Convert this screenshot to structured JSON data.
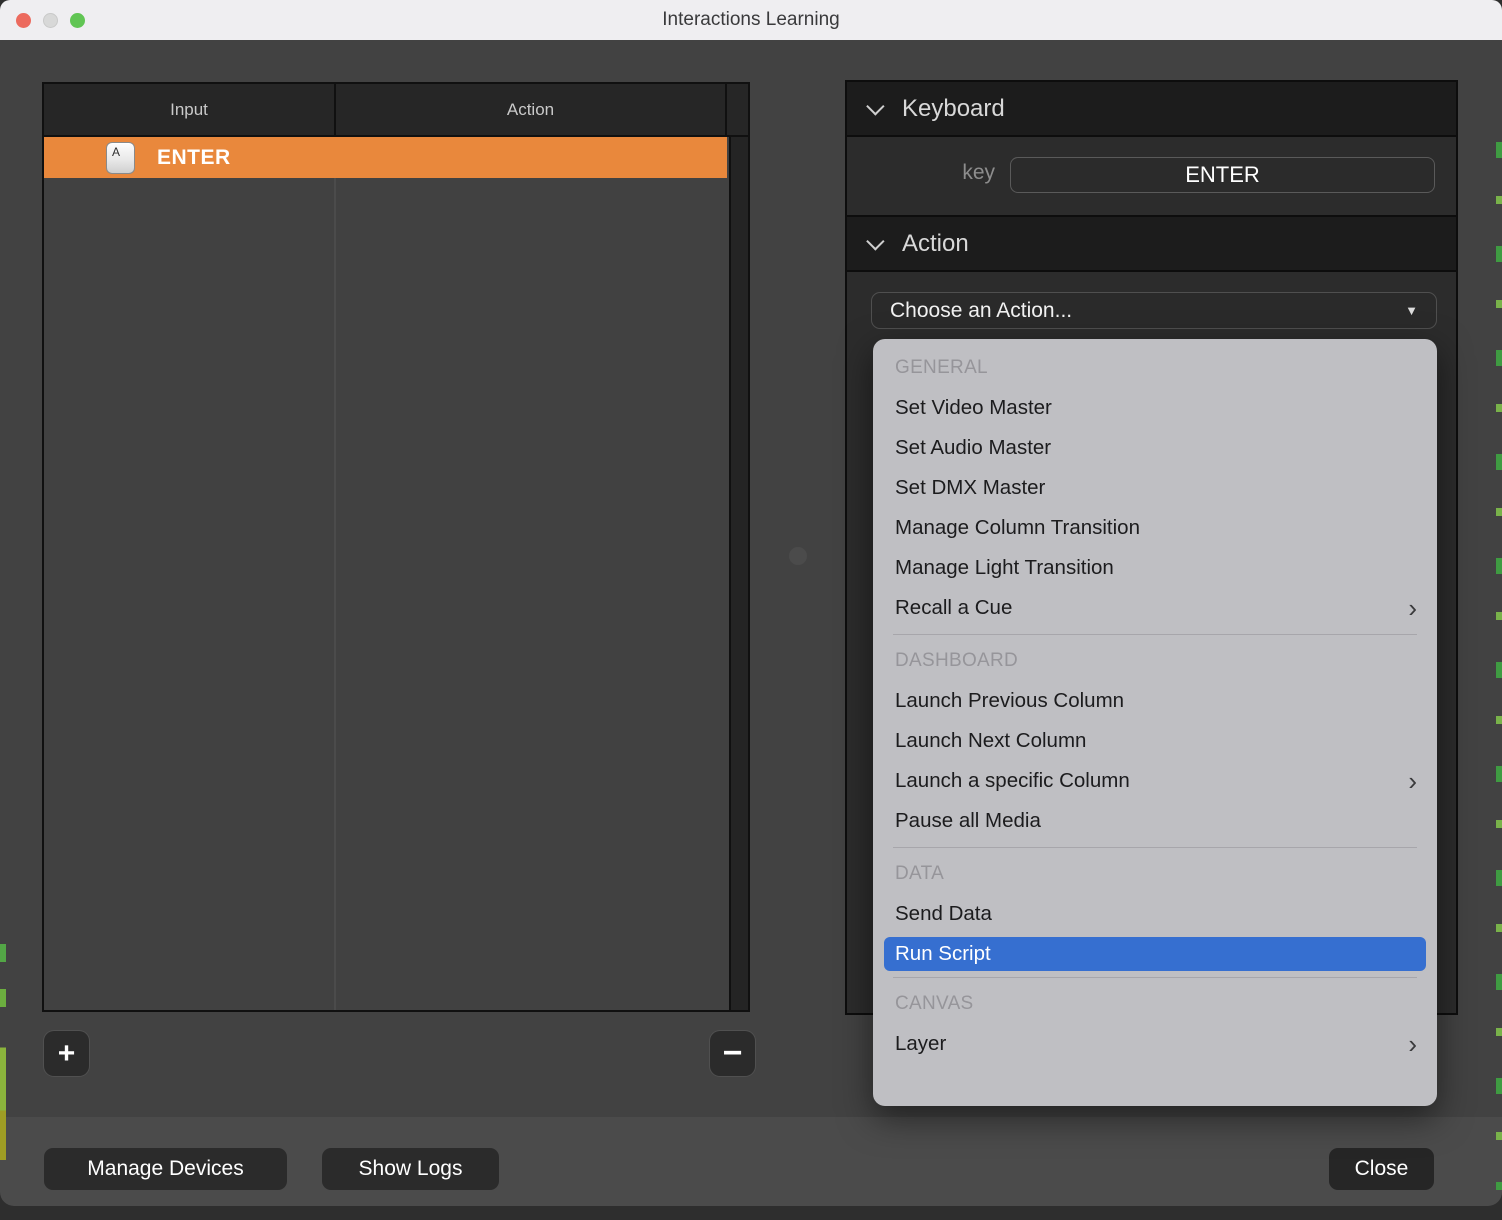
{
  "window": {
    "title": "Interactions Learning"
  },
  "table": {
    "columns": [
      "Input",
      "Action"
    ],
    "rows": [
      {
        "key_icon": "A",
        "input": "ENTER",
        "action": ""
      }
    ],
    "add_label": "+",
    "remove_label": "−"
  },
  "panel": {
    "keyboard": {
      "title": "Keyboard",
      "key_label": "key",
      "key_value": "ENTER"
    },
    "action": {
      "title": "Action",
      "dropdown_value": "Choose an Action...",
      "caret_icon": "▼"
    }
  },
  "menu": {
    "sections": [
      {
        "header": "GENERAL",
        "items": [
          {
            "label": "Set Video Master"
          },
          {
            "label": "Set Audio Master"
          },
          {
            "label": "Set DMX Master"
          },
          {
            "label": "Manage Column Transition"
          },
          {
            "label": "Manage Light Transition"
          },
          {
            "label": "Recall a Cue",
            "submenu": true
          }
        ]
      },
      {
        "header": "DASHBOARD",
        "items": [
          {
            "label": "Launch Previous Column"
          },
          {
            "label": "Launch Next Column"
          },
          {
            "label": "Launch a specific Column",
            "submenu": true
          },
          {
            "label": "Pause all Media"
          }
        ]
      },
      {
        "header": "DATA",
        "items": [
          {
            "label": "Send Data"
          },
          {
            "label": "Run Script",
            "selected": true
          }
        ]
      },
      {
        "header": "CANVAS",
        "items": [
          {
            "label": "Layer",
            "submenu": true
          }
        ]
      }
    ],
    "submenu_chevron": "›"
  },
  "footer": {
    "manage_devices_label": "Manage Devices",
    "show_logs_label": "Show Logs",
    "close_label": "Close"
  },
  "colors": {
    "row_highlight_orange": "#e9883c",
    "menu_selection_blue": "#366fd0",
    "menu_background": "#bfbfc3",
    "panel_background": "#2c2c2c",
    "window_background": "#424242",
    "titlebar_background": "#efeef1",
    "traffic_close": "#ec6a5e",
    "traffic_minimize": "#d8d8d8",
    "traffic_zoom": "#61c554"
  }
}
